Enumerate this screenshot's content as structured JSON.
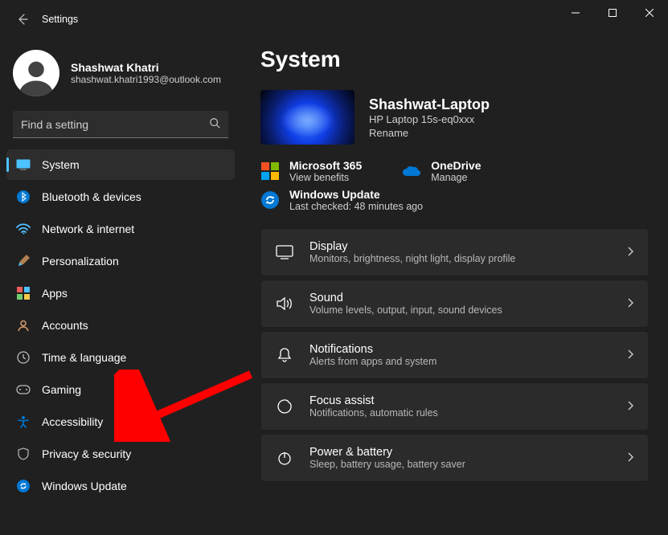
{
  "window": {
    "title": "Settings"
  },
  "user": {
    "name": "Shashwat Khatri",
    "email": "shashwat.khatri1993@outlook.com"
  },
  "search": {
    "placeholder": "Find a setting"
  },
  "sidebar": {
    "items": [
      {
        "label": "System"
      },
      {
        "label": "Bluetooth & devices"
      },
      {
        "label": "Network & internet"
      },
      {
        "label": "Personalization"
      },
      {
        "label": "Apps"
      },
      {
        "label": "Accounts"
      },
      {
        "label": "Time & language"
      },
      {
        "label": "Gaming"
      },
      {
        "label": "Accessibility"
      },
      {
        "label": "Privacy & security"
      },
      {
        "label": "Windows Update"
      }
    ]
  },
  "main": {
    "heading": "System",
    "device": {
      "name": "Shashwat-Laptop",
      "model": "HP Laptop 15s-eq0xxx",
      "rename": "Rename"
    },
    "services": [
      {
        "title": "Microsoft 365",
        "sub": "View benefits"
      },
      {
        "title": "OneDrive",
        "sub": "Manage"
      },
      {
        "title": "Windows Update",
        "sub": "Last checked: 48 minutes ago"
      }
    ],
    "cards": [
      {
        "title": "Display",
        "sub": "Monitors, brightness, night light, display profile"
      },
      {
        "title": "Sound",
        "sub": "Volume levels, output, input, sound devices"
      },
      {
        "title": "Notifications",
        "sub": "Alerts from apps and system"
      },
      {
        "title": "Focus assist",
        "sub": "Notifications, automatic rules"
      },
      {
        "title": "Power & battery",
        "sub": "Sleep, battery usage, battery saver"
      }
    ]
  },
  "annotation": {
    "target": "Accessibility"
  }
}
